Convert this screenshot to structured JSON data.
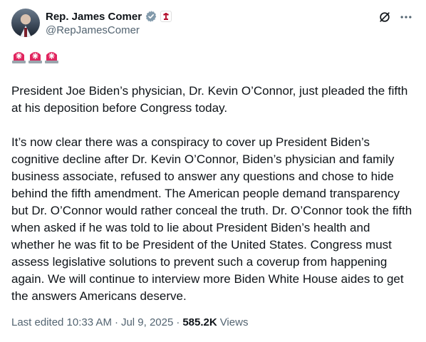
{
  "author": {
    "display_name": "Rep. James Comer",
    "handle": "@RepJamesComer",
    "verified_icon": "verified-badge-icon",
    "affiliation_icon": "us-house-seal-icon"
  },
  "actions": {
    "grok_icon": "grok-icon",
    "more_icon": "more-dots-icon"
  },
  "emoji": [
    "rotating-light",
    "rotating-light",
    "rotating-light"
  ],
  "body": {
    "paragraph_1": "President Joe Biden’s physician, Dr. Kevin O’Connor, just pleaded the fifth at his deposition before Congress today.",
    "paragraph_2": "It’s now clear there was a conspiracy to cover up President Biden’s cognitive decline after Dr. Kevin O’Connor, Biden’s physician and family business associate, refused to answer any questions and chose to hide behind the fifth amendment. The American people demand transparency but Dr. O’Connor would rather conceal the truth. Dr. O’Connor took the fifth when asked if he was told to lie about President Biden’s health and whether he was fit to be President of the United States. Congress must assess legislative solutions to prevent such a coverup from happening again. We will continue to interview more Biden White House aides to get the answers Americans deserve."
  },
  "meta": {
    "edited": "Last edited 10:33 AM",
    "sep1": "·",
    "date": "Jul 9, 2025",
    "sep2": "·",
    "views_count": "585.2K",
    "views_label": "Views"
  },
  "colors": {
    "text": "#0f1419",
    "secondary": "#536471",
    "verified_fill": "#829aab",
    "siren_red": "#e0245e"
  }
}
